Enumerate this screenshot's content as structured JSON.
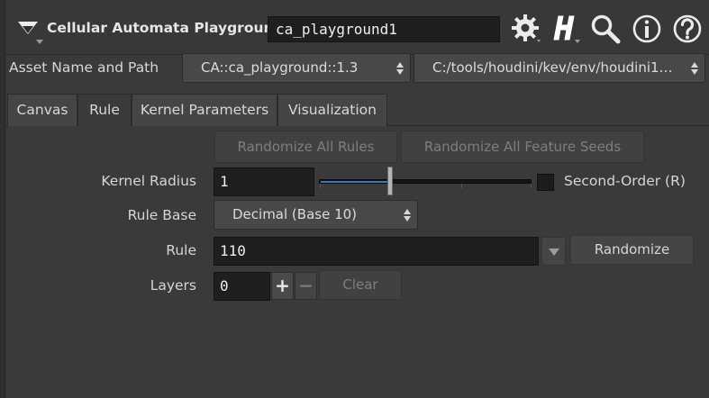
{
  "header": {
    "title": "Cellular Automata Playground",
    "node_name": "ca_playground1",
    "icons": [
      "gear-icon",
      "houdini-h-icon",
      "search-icon",
      "info-icon",
      "help-icon"
    ]
  },
  "asset": {
    "label": "Asset Name and Path",
    "name": "CA::ca_playground::1.3",
    "path": "C:/tools/houdini/kev/env/houdini1…"
  },
  "tabs": [
    {
      "label": "Canvas",
      "active": false
    },
    {
      "label": "Rule",
      "active": true
    },
    {
      "label": "Kernel Parameters",
      "active": false
    },
    {
      "label": "Visualization",
      "active": false
    }
  ],
  "rule_tab": {
    "randomize_all_rules": "Randomize All Rules",
    "randomize_all_feature_seeds": "Randomize All Feature Seeds",
    "kernel_radius": {
      "label": "Kernel Radius",
      "value": "1"
    },
    "second_order": {
      "label": "Second-Order (R)",
      "checked": false
    },
    "rule_base": {
      "label": "Rule Base",
      "value": "Decimal (Base 10)"
    },
    "rule": {
      "label": "Rule",
      "value": "110",
      "randomize_label": "Randomize"
    },
    "layers": {
      "label": "Layers",
      "value": "0",
      "plus": "+",
      "minus": "−",
      "clear_label": "Clear"
    }
  },
  "colors": {
    "background": "#3a3a3a",
    "field": "#1f1f1f",
    "slider_fill": "#3e78b8"
  }
}
